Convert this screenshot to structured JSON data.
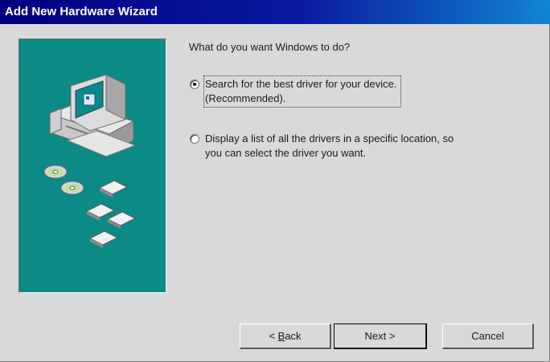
{
  "window": {
    "title": "Add New Hardware Wizard"
  },
  "main": {
    "question": "What do you want Windows to do?",
    "options": [
      {
        "line1": "Search for the best driver for your device.",
        "line2": "(Recommended).",
        "selected": true
      },
      {
        "line1": "Display a list of all the drivers in a specific location, so",
        "line2": "you can select the driver you want.",
        "selected": false
      }
    ]
  },
  "buttons": {
    "back_prefix": "< ",
    "back_mnemonic": "B",
    "back_rest": "ack",
    "next": "Next >",
    "cancel": "Cancel"
  },
  "colors": {
    "dialog": "#d9d9d9",
    "panel_teal": "#0c8a85",
    "titlebar_start": "#00007f",
    "titlebar_end": "#1084d0"
  },
  "icons": [
    "computer-icon",
    "cd-icon",
    "floppy-disk-icon"
  ]
}
